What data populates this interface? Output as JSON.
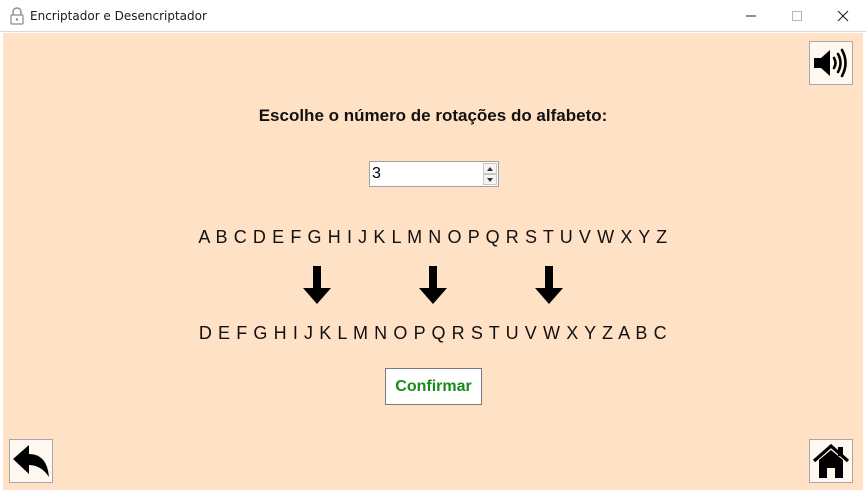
{
  "window": {
    "title": "Encriptador e Desencriptador",
    "icon": "lock-icon",
    "controls": [
      "minimize-icon",
      "maximize-icon",
      "close-icon"
    ]
  },
  "colors": {
    "background": "#ffe1c6",
    "confirm_text": "#1a8a1a"
  },
  "main": {
    "prompt": "Escolhe o número de rotações do alfabeto:",
    "rotations_value": "3",
    "alphabet_plain": "A B C D E F G H I J K L M N O P Q R S T U V W X Y Z",
    "alphabet_shifted": "D E F G H I J K L M N O P Q R S T U V W X Y Z A B C",
    "confirm_label": "Confirmar"
  },
  "buttons": {
    "sound": "speaker-icon",
    "back": "back-arrow-icon",
    "home": "home-icon"
  }
}
